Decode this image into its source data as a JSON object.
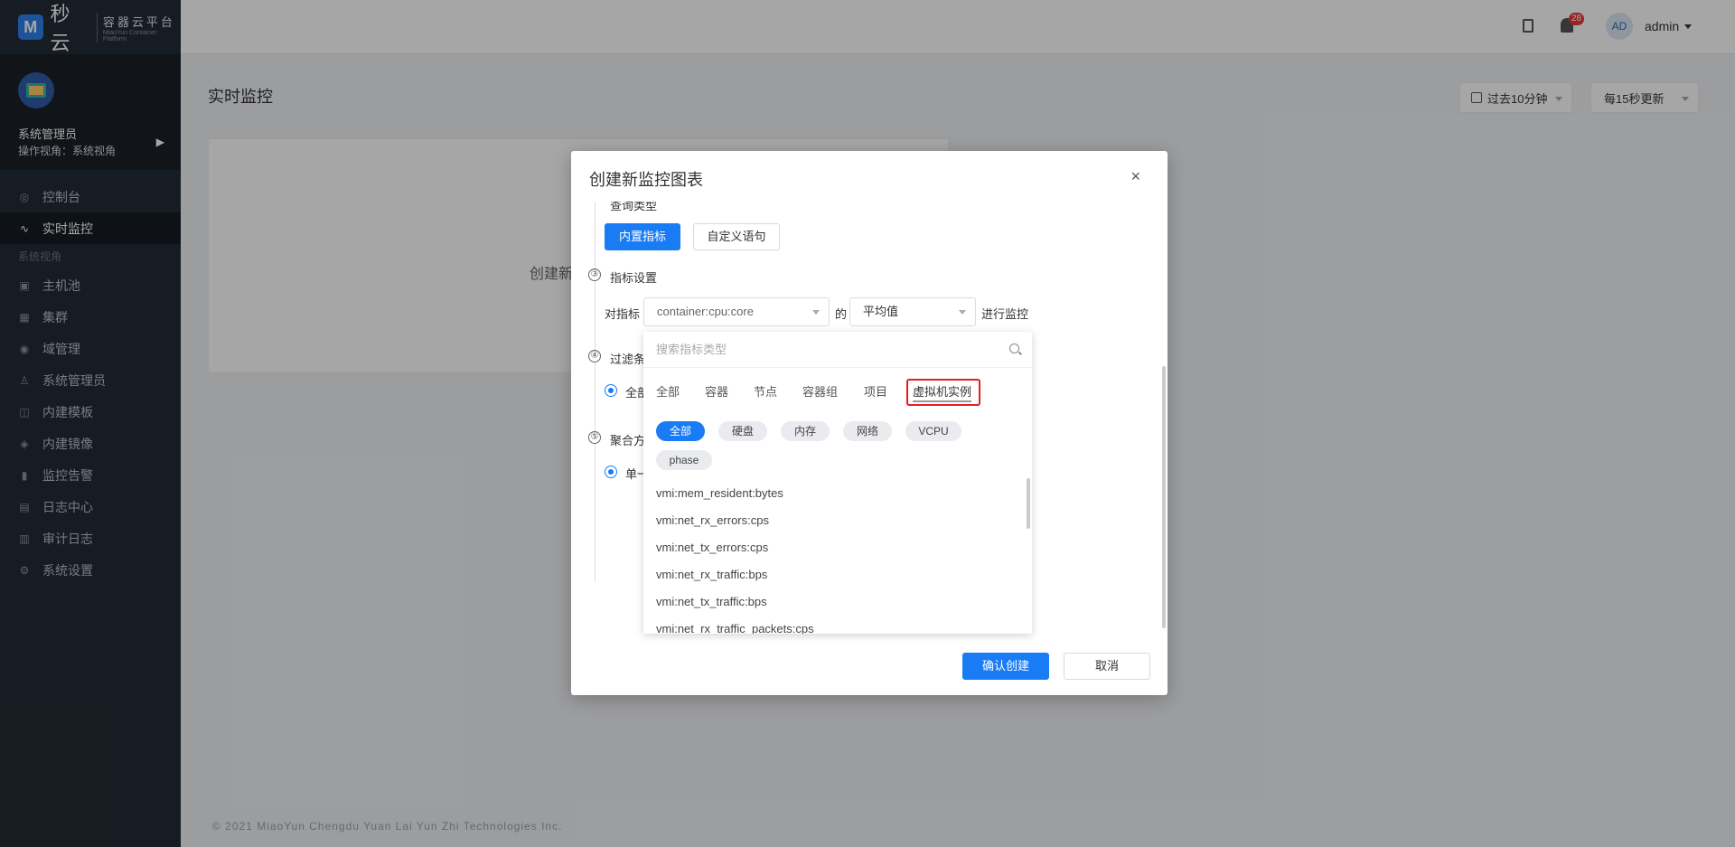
{
  "brand": {
    "logo_letter": "M",
    "name": "秒云",
    "subtitle": "容器云平台",
    "tagline": "MiaoYun Container Platform"
  },
  "user": {
    "name": "系统管理员",
    "view": "操作视角：系统视角"
  },
  "nav": {
    "top_items": [
      {
        "label": "控制台",
        "icon": "dashboard-icon"
      },
      {
        "label": "实时监控",
        "icon": "monitor-icon"
      }
    ],
    "group_label": "系统视角",
    "group_items": [
      {
        "label": "主机池",
        "icon": "host-icon"
      },
      {
        "label": "集群",
        "icon": "cluster-icon"
      },
      {
        "label": "域管理",
        "icon": "domain-icon"
      },
      {
        "label": "系统管理员",
        "icon": "admin-icon"
      },
      {
        "label": "内建模板",
        "icon": "template-icon"
      },
      {
        "label": "内建镜像",
        "icon": "image-icon"
      },
      {
        "label": "监控告警",
        "icon": "alert-icon"
      },
      {
        "label": "日志中心",
        "icon": "log-icon"
      },
      {
        "label": "审计日志",
        "icon": "audit-icon"
      },
      {
        "label": "系统设置",
        "icon": "settings-icon"
      }
    ]
  },
  "header": {
    "badge_count": "28",
    "avatar_initials": "AD",
    "username": "admin"
  },
  "page": {
    "title": "实时监控",
    "time_range": "过去10分钟",
    "refresh": "每15秒更新",
    "empty_text": "创建新",
    "footer": "© 2021 MiaoYun Chengdu Yuan Lai Yun Zhi Technologies Inc."
  },
  "modal": {
    "title": "创建新监控图表",
    "close": "×",
    "step2_label": "查询类型",
    "query_type_buttons": [
      "内置指标",
      "自定义语句"
    ],
    "step3_num": "③",
    "step3_label": "指标设置",
    "metric_prefix": "对指标",
    "metric_value": "container:cpu:core",
    "metric_of": "的",
    "aggregation_value": "平均值",
    "metric_suffix": "进行监控",
    "step4_num": "④",
    "step4_label": "过滤条",
    "step4_radio": "全部",
    "step5_num": "⑤",
    "step5_label": "聚合方",
    "step5_radio": "单一",
    "confirm": "确认创建",
    "cancel": "取消"
  },
  "dropdown": {
    "search_placeholder": "搜索指标类型",
    "tabs": [
      "全部",
      "容器",
      "节点",
      "容器组",
      "项目",
      "虚拟机实例"
    ],
    "active_tab": "虚拟机实例",
    "chips": [
      "全部",
      "硬盘",
      "内存",
      "网络",
      "VCPU",
      "phase"
    ],
    "items": [
      "vmi:mem_resident:bytes",
      "vmi:net_rx_errors:cps",
      "vmi:net_tx_errors:cps",
      "vmi:net_rx_traffic:bps",
      "vmi:net_tx_traffic:bps",
      "vmi:net_rx_traffic_packets:cps"
    ]
  },
  "colors": {
    "primary": "#1a7cf5",
    "sidebar": "#232b36",
    "highlight": "#e02020",
    "badge": "#e53935"
  }
}
